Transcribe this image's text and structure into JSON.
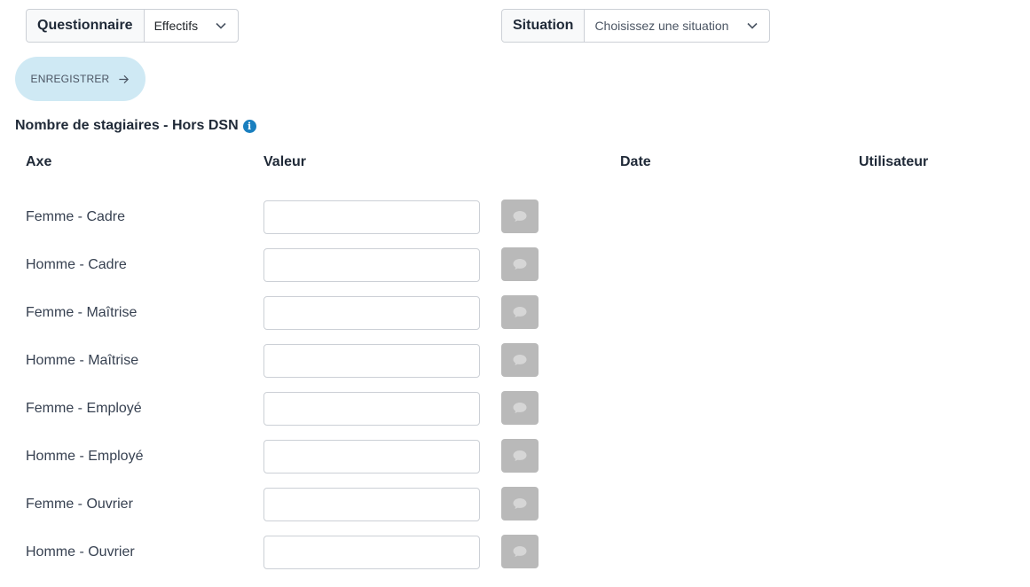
{
  "filters": {
    "questionnaire": {
      "label": "Questionnaire",
      "value": "Effectifs"
    },
    "situation": {
      "label": "Situation",
      "placeholder": "Choisissez une situation"
    }
  },
  "toolbar": {
    "save_label": "ENREGISTRER"
  },
  "section": {
    "title": "Nombre de stagiaires - Hors DSN",
    "info_icon": "i"
  },
  "table": {
    "headers": {
      "axe": "Axe",
      "valeur": "Valeur",
      "date": "Date",
      "utilisateur": "Utilisateur"
    },
    "rows": [
      {
        "axe": "Femme - Cadre",
        "valeur": ""
      },
      {
        "axe": "Homme - Cadre",
        "valeur": ""
      },
      {
        "axe": "Femme - Maîtrise",
        "valeur": ""
      },
      {
        "axe": "Homme - Maîtrise",
        "valeur": ""
      },
      {
        "axe": "Femme - Employé",
        "valeur": ""
      },
      {
        "axe": "Homme - Employé",
        "valeur": ""
      },
      {
        "axe": "Femme - Ouvrier",
        "valeur": ""
      },
      {
        "axe": "Homme - Ouvrier",
        "valeur": ""
      }
    ]
  },
  "colors": {
    "accent": "#1a7fbf",
    "save_button_bg": "#cfe9f4",
    "comment_button_bg": "#b9b9b9"
  }
}
